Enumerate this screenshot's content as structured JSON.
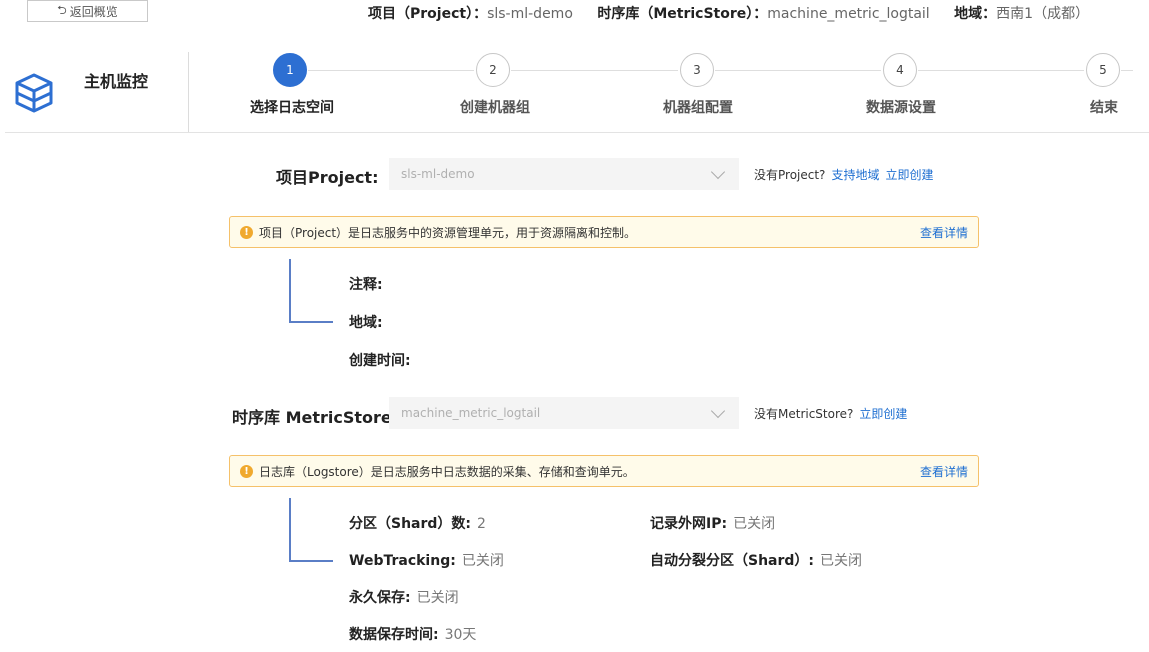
{
  "top": {
    "back_label": "返回概览",
    "project_label": "项目（Project）：",
    "project_value": "sls-ml-demo",
    "store_label": "时序库（MetricStore）：",
    "store_value": "machine_metric_logtail",
    "region_label": "地域：",
    "region_value": "西南1（成都）"
  },
  "header": {
    "title": "主机监控",
    "logo_icon": "cube-stack-icon",
    "accent": "#2d6fd2"
  },
  "steps": [
    {
      "num": "1",
      "label": "选择日志空间"
    },
    {
      "num": "2",
      "label": "创建机器组"
    },
    {
      "num": "3",
      "label": "机器组配置"
    },
    {
      "num": "4",
      "label": "数据源设置"
    },
    {
      "num": "5",
      "label": "结束"
    }
  ],
  "project": {
    "label": "项目Project:",
    "value": "sls-ml-demo",
    "hint": "没有Project?",
    "link_region": "支持地域",
    "link_create": "立即创建",
    "notice": "项目（Project）是日志服务中的资源管理单元，用于资源隔离和控制。",
    "notice_link": "查看详情",
    "details": {
      "comment": "注释:",
      "region": "地域:",
      "created": "创建时间:"
    }
  },
  "metricstore": {
    "label": "时序库 MetricStore:",
    "value": "machine_metric_logtail",
    "hint": "没有MetricStore?",
    "link_create": "立即创建",
    "notice": "日志库（Logstore）是日志服务中日志数据的采集、存储和查询单元。",
    "notice_link": "查看详情",
    "details": {
      "shard_label": "分区（Shard）数:",
      "shard_value": "2",
      "ip_label": "记录外网IP:",
      "ip_value": "已关闭",
      "webtracking_label": "WebTracking:",
      "webtracking_value": "已关闭",
      "autosplit_label": "自动分裂分区（Shard）:",
      "autosplit_value": "已关闭",
      "permanent_label": "永久保存:",
      "permanent_value": "已关闭",
      "retention_label": "数据保存时间:",
      "retention_value": "30天"
    }
  }
}
